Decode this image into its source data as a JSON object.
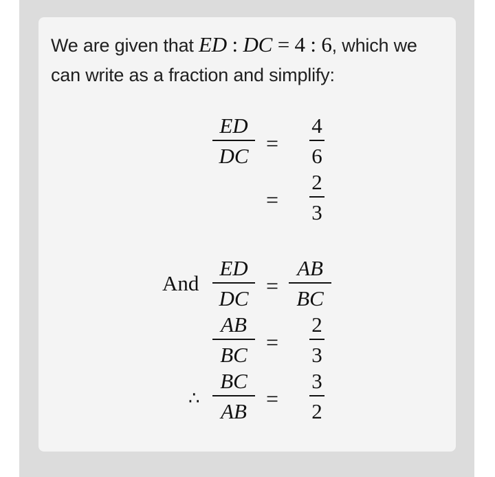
{
  "intro": {
    "prefix": "We are given that ",
    "ratio_left": "ED",
    "ratio_colon": " : ",
    "ratio_mid": "DC",
    "ratio_eq": " = ",
    "ratio_values": "4 : 6",
    "suffix": ", which we can write as a fraction and simplify:"
  },
  "block1": {
    "row1": {
      "lhs_num": "ED",
      "lhs_den": "DC",
      "eq": "=",
      "rhs_num": "4",
      "rhs_den": "6"
    },
    "row2": {
      "eq": "=",
      "rhs_num": "2",
      "rhs_den": "3"
    }
  },
  "block2": {
    "and_label": "And",
    "therefore_symbol": "∴",
    "row1": {
      "lhs_num": "ED",
      "lhs_den": "DC",
      "eq": "=",
      "rhs_num": "AB",
      "rhs_den": "BC"
    },
    "row2": {
      "lhs_num": "AB",
      "lhs_den": "BC",
      "eq": "=",
      "rhs_num": "2",
      "rhs_den": "3"
    },
    "row3": {
      "lhs_num": "BC",
      "lhs_den": "AB",
      "eq": "=",
      "rhs_num": "3",
      "rhs_den": "2"
    }
  }
}
